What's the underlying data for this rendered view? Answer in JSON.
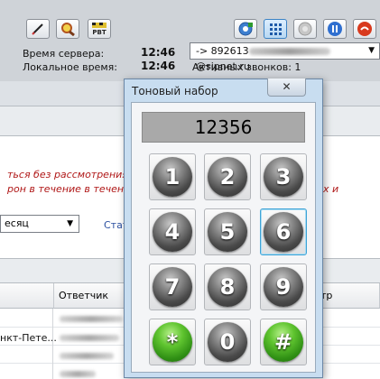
{
  "toolbar": {
    "left_buttons": [
      "pen-icon",
      "magnifier-icon",
      "pbt-icon"
    ],
    "pbt_label": "PBT",
    "right_buttons": [
      "add-contact-icon",
      "dialpad-icon",
      "hold-icon",
      "pause-icon",
      "hangup-icon"
    ]
  },
  "server_time": {
    "label": "Время сервера:",
    "value": "12:46"
  },
  "local_time": {
    "label": "Локальное время:",
    "value": "12:46"
  },
  "call": {
    "prefix": "-> 892613",
    "suffix": "@sipnet.ru",
    "active_calls": "Активных звонков: 1"
  },
  "background": {
    "warning_line1": "ться без рассмотрения",
    "warning_line1_tail": "х и",
    "warning_line2": "рон в течение в течени",
    "period_value": "есяц",
    "stat_link": "Стат",
    "table": {
      "header_answerer": "Ответчик",
      "header_tail": "тр",
      "row2_city": "нкт-Пете..."
    }
  },
  "dialog": {
    "title": "Тоновый набор",
    "close_label": "✕",
    "display_value": "12356",
    "keys": [
      "1",
      "2",
      "3",
      "4",
      "5",
      "6",
      "7",
      "8",
      "9",
      "*",
      "0",
      "#"
    ]
  },
  "colors": {
    "warning_text": "#b01818",
    "link_text": "#2a4fa0",
    "dialog_frame": "#c8ddf0",
    "selected_key_border": "#3ea3d6"
  }
}
